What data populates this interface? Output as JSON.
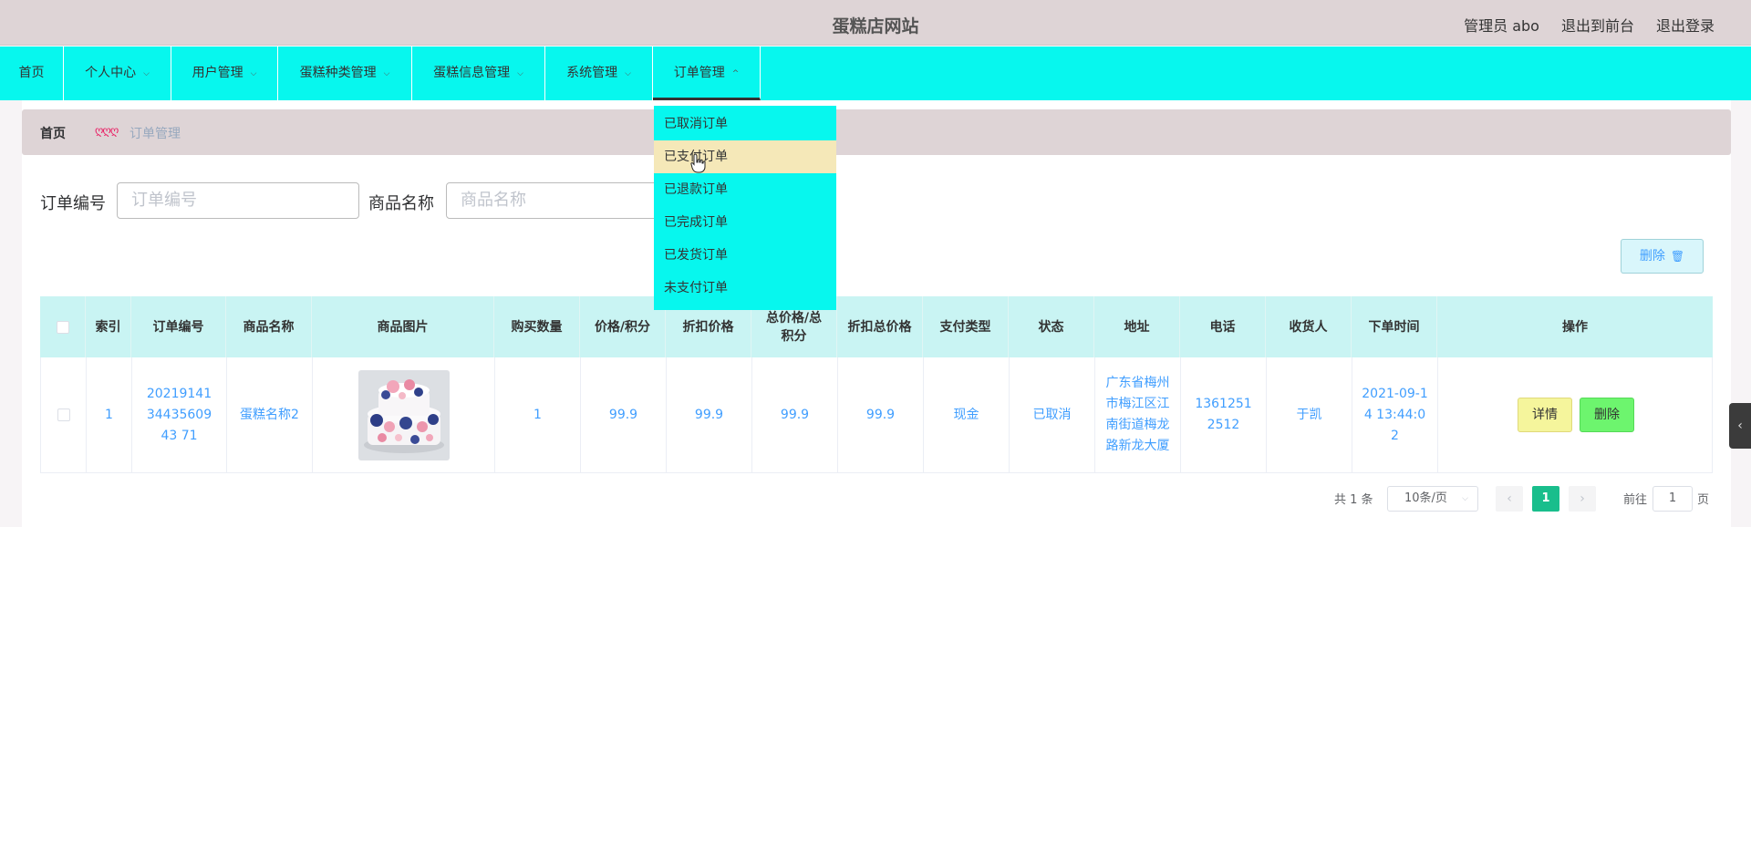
{
  "header": {
    "title": "蛋糕店网站",
    "admin_label": "管理员 abo",
    "to_front_label": "退出到前台",
    "logout_label": "退出登录"
  },
  "nav": {
    "items": [
      {
        "label": "首页",
        "has_dropdown": false
      },
      {
        "label": "个人中心",
        "has_dropdown": true
      },
      {
        "label": "用户管理",
        "has_dropdown": true
      },
      {
        "label": "蛋糕种类管理",
        "has_dropdown": true
      },
      {
        "label": "蛋糕信息管理",
        "has_dropdown": true
      },
      {
        "label": "系统管理",
        "has_dropdown": true
      },
      {
        "label": "订单管理",
        "has_dropdown": true,
        "active": true
      }
    ],
    "chevron_down": "⌵",
    "chevron_up": "^"
  },
  "dropdown": {
    "items": [
      "已取消订单",
      "已支付订单",
      "已退款订单",
      "已完成订单",
      "已发货订单",
      "未支付订单"
    ],
    "hovered_index": 1
  },
  "breadcrumb": {
    "home": "首页",
    "separator": "ღღღ",
    "current": "订单管理"
  },
  "search": {
    "order_no_label": "订单编号",
    "order_no_placeholder": "订单编号",
    "product_label": "商品名称",
    "product_placeholder": "商品名称"
  },
  "toolbar": {
    "delete_label": "删除",
    "trash_glyph": "🗑"
  },
  "table": {
    "headers": [
      "索引",
      "订单编号",
      "商品名称",
      "商品图片",
      "购买数量",
      "价格/积分",
      "折扣价格",
      "总价格/总积分",
      "折扣总价格",
      "支付类型",
      "状态",
      "地址",
      "电话",
      "收货人",
      "下单时间",
      "操作"
    ],
    "rows": [
      {
        "index": "1",
        "order_no": "202191413443560943 71",
        "product_name": "蛋糕名称2",
        "quantity": "1",
        "price": "99.9",
        "discount_price": "99.9",
        "total_price": "99.9",
        "discount_total": "99.9",
        "pay_type": "现金",
        "status": "已取消",
        "address": "广东省梅州市梅江区江南街道梅龙路新龙大厦",
        "phone": "13612512512",
        "receiver": "于凯",
        "order_time": "2021-09-14 13:44:02",
        "detail_label": "详情",
        "delete_label": "删除"
      }
    ]
  },
  "pagination": {
    "total_label": "共 1 条",
    "page_size": "10条/页",
    "current_page": "1",
    "goto_prefix": "前往",
    "goto_value": "1",
    "goto_suffix": "页",
    "prev": "‹",
    "next": "›"
  },
  "side_tab": {
    "glyph": "‹"
  },
  "colors": {
    "nav_bg": "#07f7ee",
    "header_bg": "#ded4d6",
    "table_header_bg": "#c9f4f3",
    "link_blue": "#409eff",
    "page_active": "#19be8c"
  }
}
